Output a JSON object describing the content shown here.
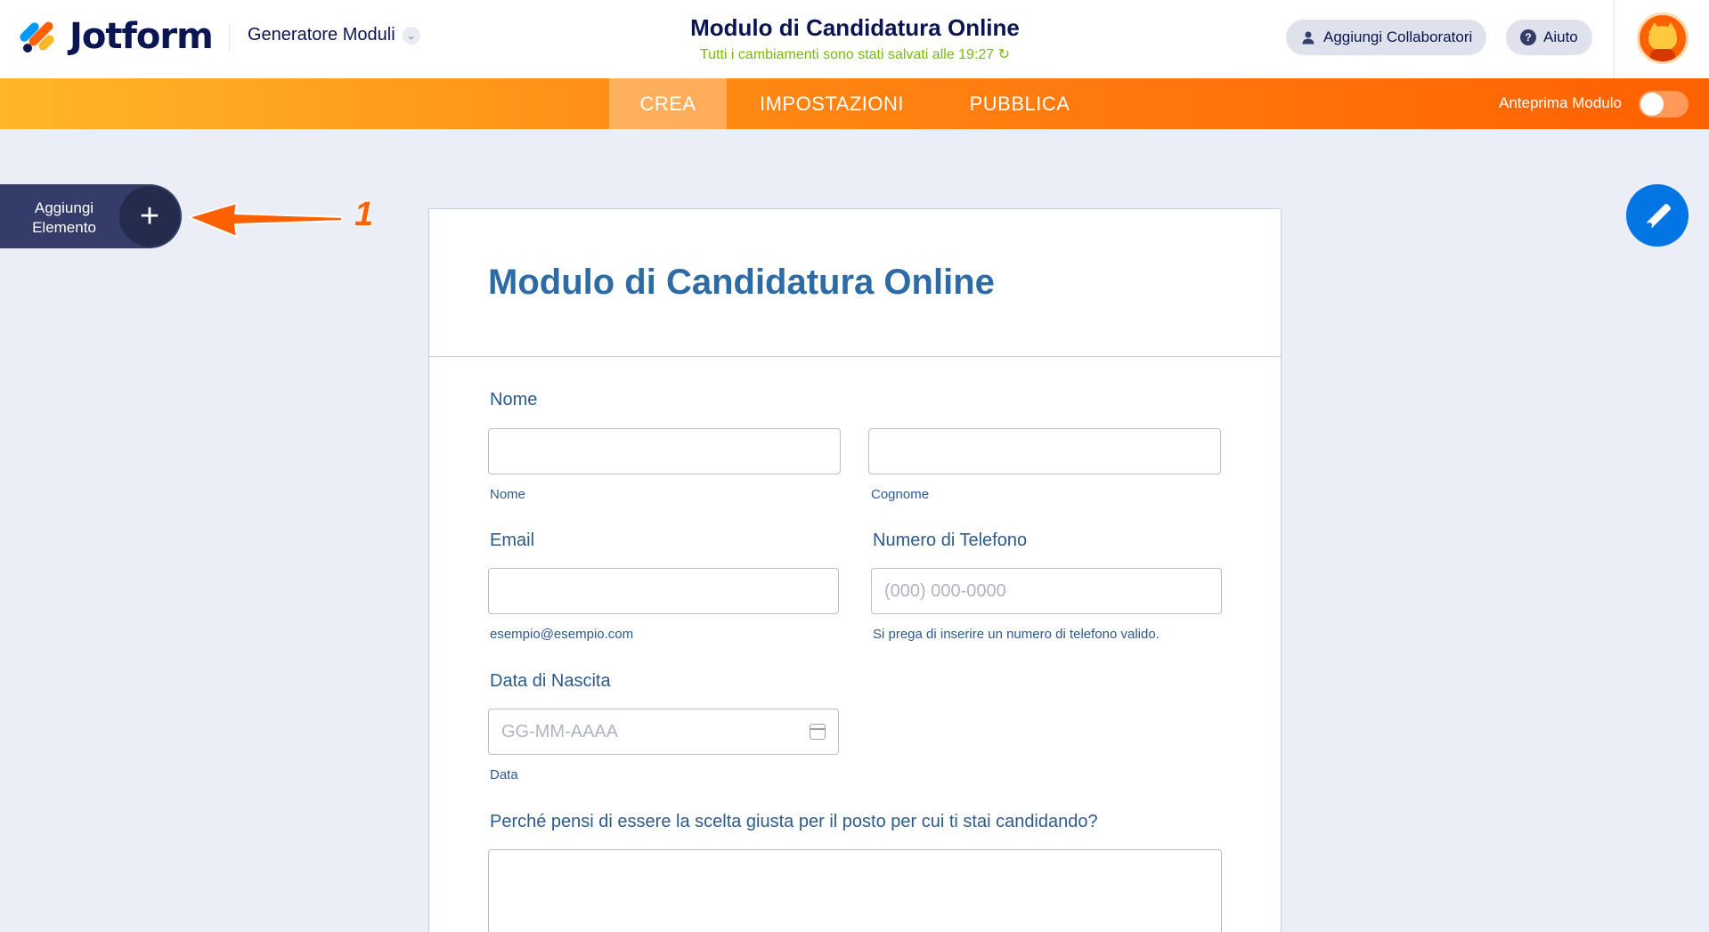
{
  "header": {
    "brand": "Jotform",
    "builder_label": "Generatore Moduli",
    "form_title": "Modulo di Candidatura Online",
    "save_status": "Tutti i cambiamenti sono stati salvati alle 19:27 ↻",
    "collaborators_label": "Aggiungi Collaboratori",
    "help_label": "Aiuto"
  },
  "nav": {
    "tabs": [
      {
        "label": "CREA",
        "active": true
      },
      {
        "label": "IMPOSTAZIONI",
        "active": false
      },
      {
        "label": "PUBBLICA",
        "active": false
      }
    ],
    "preview_label": "Anteprima Modulo",
    "preview_on": false
  },
  "sidebar": {
    "add_element_label": "Aggiungi Elemento",
    "annotation_number": "1"
  },
  "form": {
    "title": "Modulo di Candidatura Online",
    "name": {
      "label": "Nome",
      "first_sublabel": "Nome",
      "last_sublabel": "Cognome"
    },
    "email": {
      "label": "Email",
      "sublabel": "esempio@esempio.com"
    },
    "phone": {
      "label": "Numero di Telefono",
      "placeholder": "(000) 000-0000",
      "sublabel": "Si prega di inserire un numero di telefono valido."
    },
    "birthdate": {
      "label": "Data di Nascita",
      "placeholder": "GG-MM-AAAA",
      "sublabel": "Data"
    },
    "question": {
      "label": "Perché pensi di essere la scelta giusta per il posto per cui ti stai candidando?"
    }
  },
  "colors": {
    "accent_orange": "#ff6100",
    "navy": "#0a1551",
    "field_label_blue": "#2c5a8c",
    "title_blue": "#2c6ba5",
    "save_green": "#78bb07",
    "designer_blue": "#0075e3"
  }
}
